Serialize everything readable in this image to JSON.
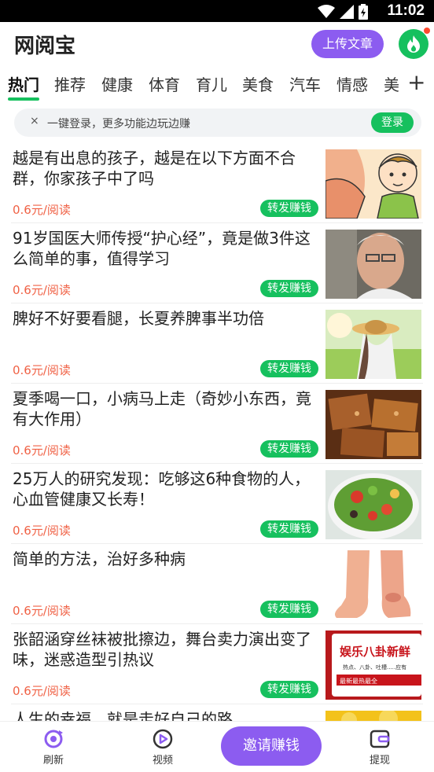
{
  "status_bar": {
    "time": "11:02",
    "icons": [
      "wifi-icon",
      "signal-icon",
      "battery-icon"
    ]
  },
  "header": {
    "app_title": "网阅宝",
    "upload_label": "上传文章",
    "fire_icon": "fire-icon",
    "accent": "#8c5cf0",
    "green": "#16c05e"
  },
  "tabs": [
    {
      "label": "热门",
      "active": true
    },
    {
      "label": "推荐"
    },
    {
      "label": "健康"
    },
    {
      "label": "体育"
    },
    {
      "label": "育儿"
    },
    {
      "label": "美食"
    },
    {
      "label": "汽车"
    },
    {
      "label": "情感"
    },
    {
      "label": "美"
    }
  ],
  "tab_add": "+",
  "login_bar": {
    "close": "×",
    "text": "一键登录，更多功能边玩边赚",
    "button": "登录"
  },
  "articles": [
    {
      "title": "越是有出息的孩子，越是在以下方面不合群，你家孩子中了吗",
      "price": "0.6元/阅读",
      "share": "转发赚钱"
    },
    {
      "title": "91岁国医大师传授“护心经”，竟是做3件这么简单的事，值得学习",
      "price": "0.6元/阅读",
      "share": "转发赚钱"
    },
    {
      "title": "脾好不好要看腿，长夏养脾事半功倍",
      "price": "0.6元/阅读",
      "share": "转发赚钱"
    },
    {
      "title": "夏季喝一口，小病马上走（奇妙小东西，竟有大作用）",
      "price": "0.6元/阅读",
      "share": "转发赚钱"
    },
    {
      "title": "25万人的研究发现：吃够这6种食物的人，心血管健康又长寿！",
      "price": "0.6元/阅读",
      "share": "转发赚钱"
    },
    {
      "title": "简单的方法，治好多种病",
      "price": "0.6元/阅读",
      "share": "转发赚钱"
    },
    {
      "title": "张韶涵穿丝袜被批擦边，舞台卖力演出变了味，迷惑造型引热议",
      "price": "0.6元/阅读",
      "share": "转发赚钱"
    },
    {
      "title": "人生的幸福，就是走好自己的路",
      "price": "",
      "share": ""
    }
  ],
  "thumb_text": {
    "banner_title": "娱乐八卦新鲜",
    "banner_sub": "热点、八卦、吐槽.....应有",
    "banner_tag": "最新最热最全"
  },
  "bottom_nav": {
    "refresh": "刷新",
    "video": "视频",
    "invite": "邀请赚钱",
    "withdraw": "提现"
  }
}
